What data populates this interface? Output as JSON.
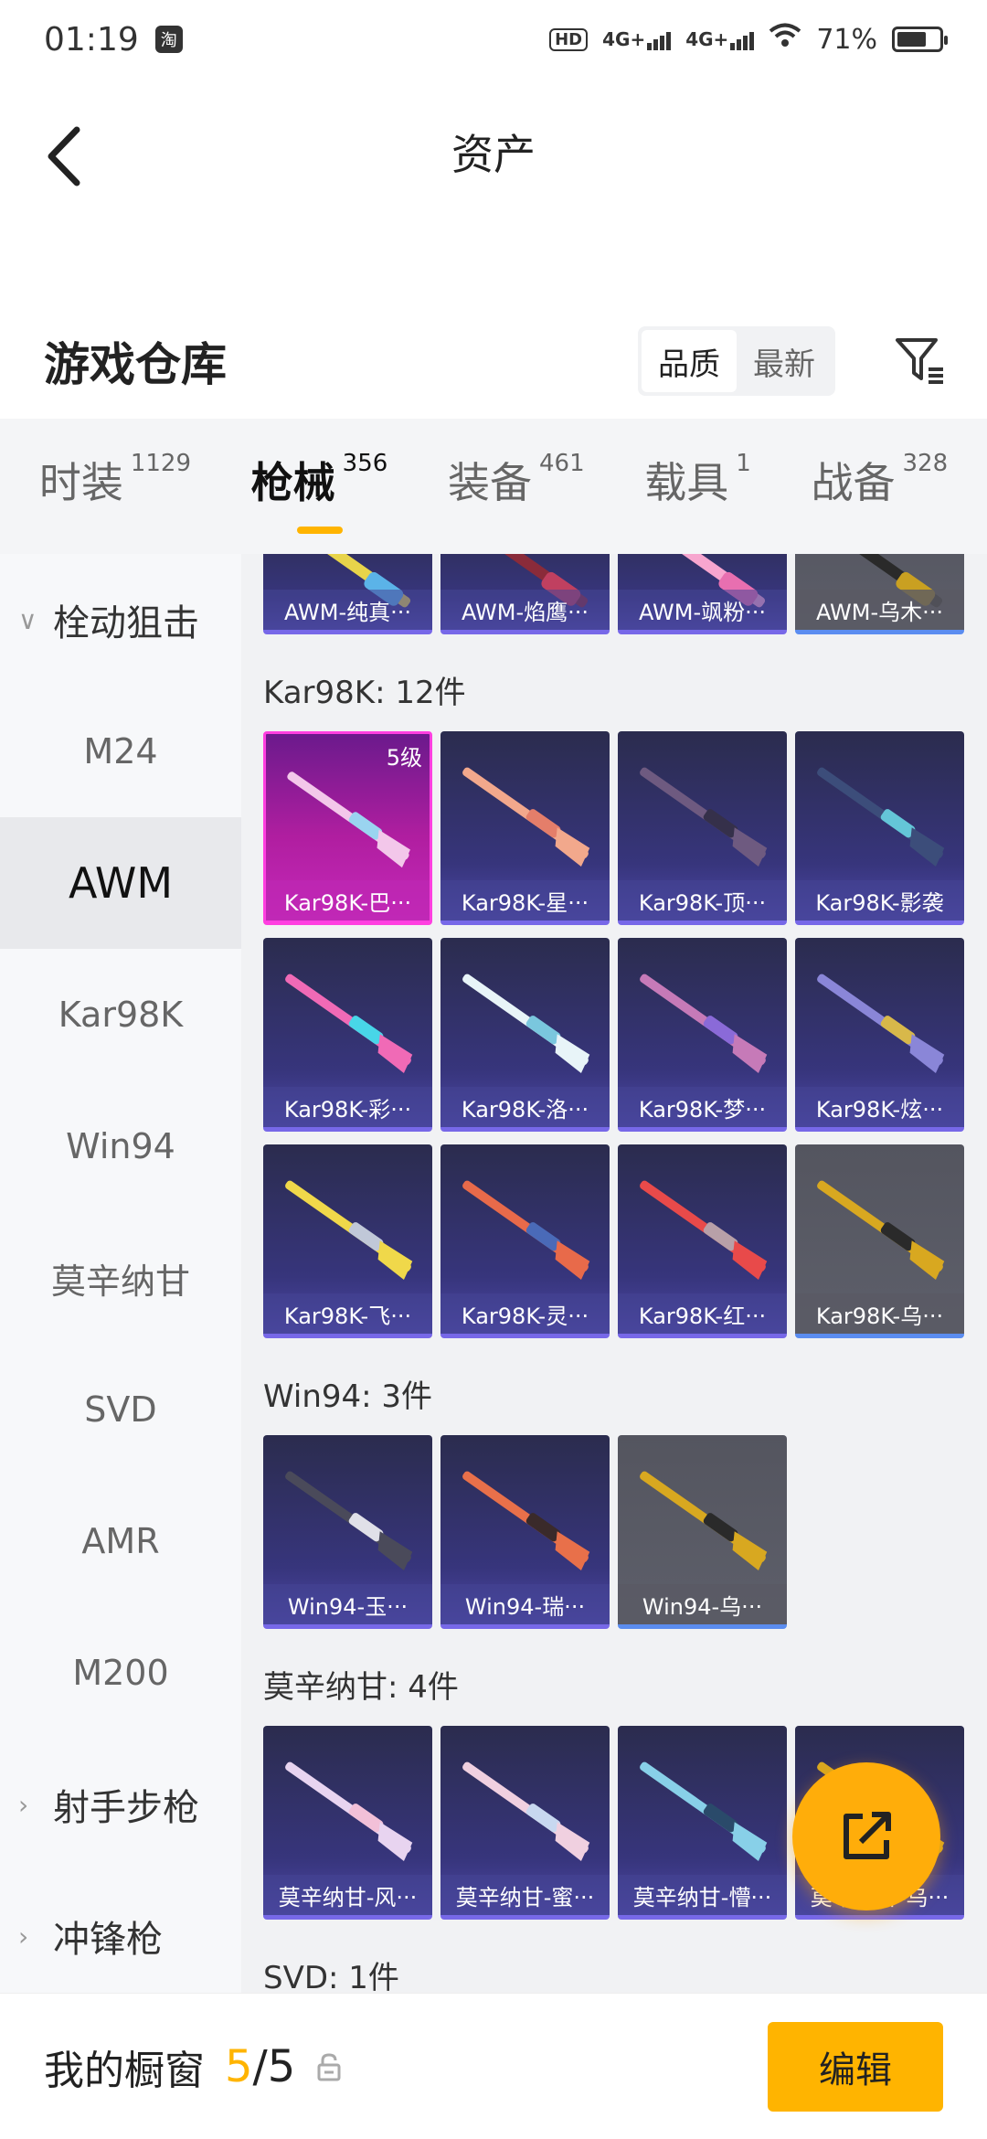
{
  "status_bar": {
    "time": "01:19",
    "app_badge": "淘",
    "hd_label": "HD",
    "signal1": "4G+",
    "signal2": "4G+",
    "battery_percent": "71%",
    "battery_level": 0.71
  },
  "header": {
    "title": "资产"
  },
  "warehouse": {
    "title": "游戏仓库",
    "sort_options": [
      "品质",
      "最新"
    ],
    "active_sort": "品质"
  },
  "tabs": [
    {
      "label": "时装",
      "count": "1129"
    },
    {
      "label": "枪械",
      "count": "356"
    },
    {
      "label": "装备",
      "count": "461"
    },
    {
      "label": "载具",
      "count": "1"
    },
    {
      "label": "战备",
      "count": "328"
    }
  ],
  "sidebar": {
    "items": [
      {
        "label": "栓动狙击",
        "type": "group",
        "chevron": "∨"
      },
      {
        "label": "M24"
      },
      {
        "label": "AWM"
      },
      {
        "label": "Kar98K"
      },
      {
        "label": "Win94"
      },
      {
        "label": "莫辛纳甘"
      },
      {
        "label": "SVD"
      },
      {
        "label": "AMR"
      },
      {
        "label": "M200"
      },
      {
        "label": "射手步枪",
        "type": "group",
        "chevron": "›"
      },
      {
        "label": "冲锋枪",
        "type": "group",
        "chevron": "›"
      }
    ]
  },
  "content": {
    "awm_partial": [
      "AWM-纯真···",
      "AWM-焰鹰···",
      "AWM-飒粉···",
      "AWM-乌木···"
    ],
    "kar98k": {
      "title": "Kar98K: 12件",
      "items": [
        {
          "name": "Kar98K-巴···",
          "level": "5级"
        },
        {
          "name": "Kar98K-星···"
        },
        {
          "name": "Kar98K-顶···"
        },
        {
          "name": "Kar98K-影袭"
        },
        {
          "name": "Kar98K-彩···"
        },
        {
          "name": "Kar98K-洛···"
        },
        {
          "name": "Kar98K-梦···"
        },
        {
          "name": "Kar98K-炫···"
        },
        {
          "name": "Kar98K-飞···"
        },
        {
          "name": "Kar98K-灵···"
        },
        {
          "name": "Kar98K-红···"
        },
        {
          "name": "Kar98K-乌···"
        }
      ]
    },
    "win94": {
      "title": "Win94: 3件",
      "items": [
        {
          "name": "Win94-玉···"
        },
        {
          "name": "Win94-瑞···"
        },
        {
          "name": "Win94-乌···"
        }
      ]
    },
    "mosin": {
      "title": "莫辛纳甘: 4件",
      "items": [
        {
          "name": "莫辛纳甘-风···"
        },
        {
          "name": "莫辛纳甘-蜜···"
        },
        {
          "name": "莫辛纳甘-懵···"
        },
        {
          "name": "莫辛纳甘-乌···"
        }
      ]
    },
    "svd": {
      "title": "SVD: 1件"
    }
  },
  "bottom_bar": {
    "label": "我的橱窗",
    "current": "5",
    "separator": "/",
    "total": "5",
    "edit_label": "编辑"
  }
}
